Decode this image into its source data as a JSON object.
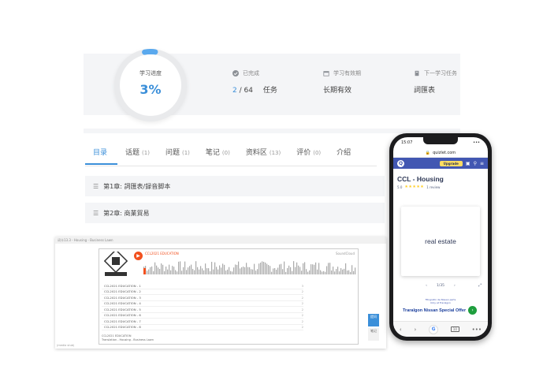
{
  "progress": {
    "label": "学习进度",
    "value": "3%",
    "fraction": 0.03
  },
  "stats": {
    "completed": {
      "label": "已完成",
      "done": "2",
      "total": "/ 64",
      "unit": "任务"
    },
    "validity": {
      "label": "学习有效期",
      "value": "长期有效"
    },
    "next": {
      "label": "下一学习任务",
      "value": "詞匯表"
    }
  },
  "tabs": [
    {
      "label": "目录",
      "count": ""
    },
    {
      "label": "话题",
      "count": "(1)"
    },
    {
      "label": "问题",
      "count": "(1)"
    },
    {
      "label": "笔记",
      "count": "(0)"
    },
    {
      "label": "资料区",
      "count": "(13)"
    },
    {
      "label": "评价",
      "count": "(0)"
    },
    {
      "label": "介绍",
      "count": ""
    }
  ],
  "chapters": [
    {
      "label": "第1章: 詞匯表/録音脚本"
    },
    {
      "label": "第2章: 商業貿易"
    }
  ],
  "player": {
    "window_title": "词卡13.3 - Housing - Business Lawn",
    "track_title": "CCL2021 EDUCATION",
    "brand": "SoundCloud",
    "tracks": [
      {
        "title": "CCL2021 EDUCATION - 1",
        "num": "3"
      },
      {
        "title": "CCL2021 EDUCATION - 2",
        "num": "2"
      },
      {
        "title": "CCL2021 EDUCATION - 3",
        "num": "2"
      },
      {
        "title": "CCL2021 EDUCATION - 4",
        "num": "2"
      },
      {
        "title": "CCL2021 EDUCATION - 5",
        "num": "2"
      },
      {
        "title": "CCL2021 EDUCATION - 6",
        "num": "2"
      },
      {
        "title": "CCL2021 EDUCATION - 7",
        "num": "2"
      },
      {
        "title": "CCL2021 EDUCATION - 8",
        "num": "2"
      }
    ],
    "footer_line1": "CCL2021 EDUCATION",
    "footer_line2": "Translation - Housing - Business Lawn",
    "status": "(media stub)"
  },
  "side_tools": [
    {
      "label": "提问"
    },
    {
      "label": "笔记"
    }
  ],
  "phone": {
    "time": "15:07",
    "signal": "•••",
    "url": "quizlet.com",
    "upgrade": "Upgrade",
    "set_title": "CCL - Housing",
    "rating_score": "5.0",
    "stars": "★★★★★",
    "reviews": "1 review",
    "card_text": "real estate",
    "card_counter": "1/35",
    "ad_small_1": "Fitngratin de Nissan parts",
    "ad_small_2": "Only at Traralgon",
    "ad_text": "Traralgon Nissan Special Offer",
    "tabs_count": "10"
  },
  "colors": {
    "accent": "#3b8fd9",
    "quizlet_blue": "#4257b2",
    "play_orange": "#f2501e"
  }
}
